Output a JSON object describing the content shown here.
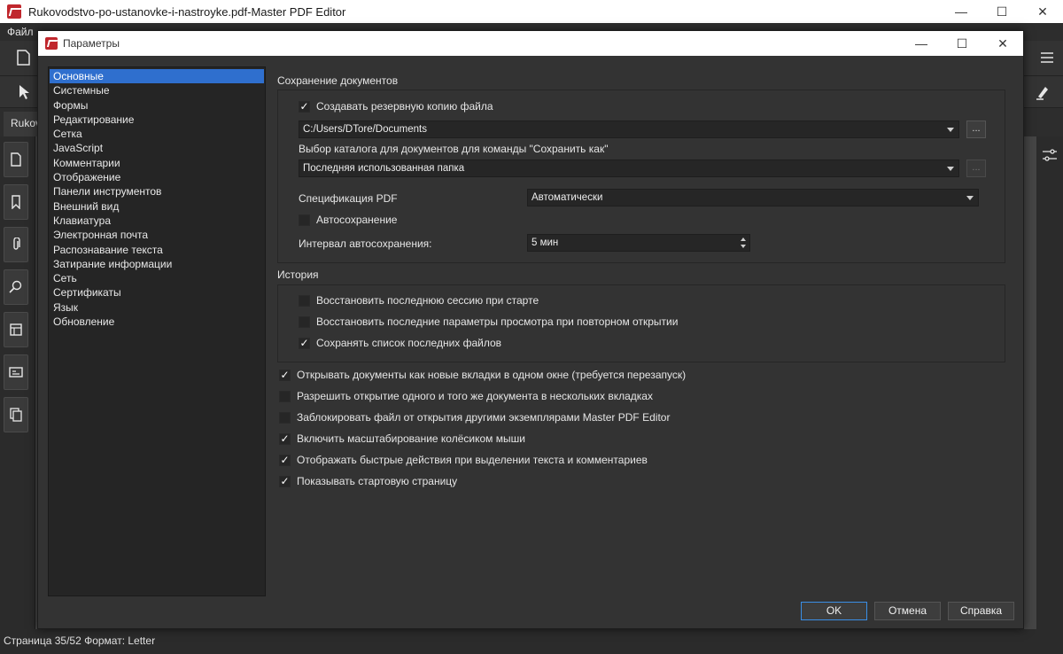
{
  "app": {
    "title": "Rukovodstvo-po-ustanovke-i-nastroyke.pdf-Master PDF Editor",
    "menu": [
      "Файл"
    ],
    "doc_tab": "Rukov",
    "status": "Страница 35/52 Формат: Letter"
  },
  "dialog": {
    "title": "Параметры",
    "nav": [
      "Основные",
      "Системные",
      "Формы",
      "Редактирование",
      "Сетка",
      "JavaScript",
      "Комментарии",
      "Отображение",
      "Панели инструментов",
      "Внешний вид",
      "Клавиатура",
      "Электронная почта",
      "Распознавание текста",
      "Затирание информации",
      "Сеть",
      "Сертификаты",
      "Язык",
      "Обновление"
    ],
    "save": {
      "title": "Сохранение документов",
      "backup_label": "Создавать резервную копию файла",
      "backup_checked": true,
      "backup_path": "C:/Users/DTore/Documents",
      "browse_label": "...",
      "saveas_label": "Выбор каталога для документов для команды \"Сохранить как\"",
      "saveas_value": "Последняя использованная папка",
      "pdfspec_label": "Спецификация PDF",
      "pdfspec_value": "Автоматически",
      "autosave_label": "Автосохранение",
      "autosave_checked": false,
      "interval_label": "Интервал автосохранения:",
      "interval_value": "5 мин"
    },
    "history": {
      "title": "История",
      "items": [
        {
          "label": "Восстановить последнюю сессию при старте",
          "checked": false
        },
        {
          "label": "Восстановить последние параметры просмотра при повторном открытии",
          "checked": false
        },
        {
          "label": "Сохранять список последних файлов",
          "checked": true
        }
      ]
    },
    "general": [
      {
        "label": "Открывать документы как новые вкладки в одном окне (требуется перезапуск)",
        "checked": true
      },
      {
        "label": "Разрешить открытие одного и того же документа в нескольких вкладках",
        "checked": false
      },
      {
        "label": "Заблокировать файл от открытия другими экземплярами Master PDF Editor",
        "checked": false
      },
      {
        "label": "Включить масштабирование колёсиком мыши",
        "checked": true
      },
      {
        "label": "Отображать быстрые действия при выделении текста и комментариев",
        "checked": true
      },
      {
        "label": "Показывать стартовую страницу",
        "checked": true
      }
    ],
    "buttons": {
      "ok": "OK",
      "cancel": "Отмена",
      "help": "Справка"
    }
  },
  "colors": {
    "accent": "#2f6fce",
    "default_border": "#3a8ee6",
    "logo": "#c0272d"
  }
}
